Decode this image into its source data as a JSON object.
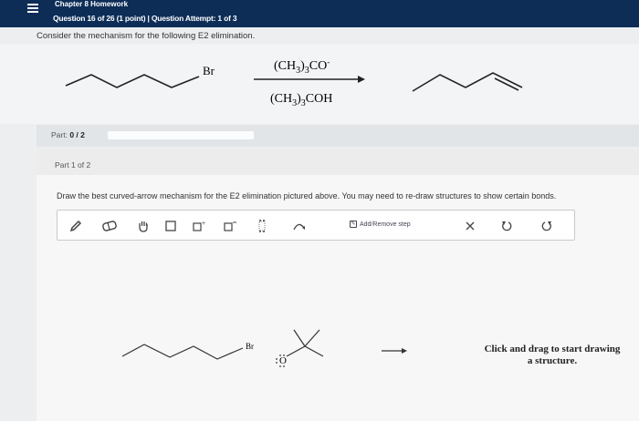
{
  "header": {
    "chapter": "Chapter 8 Homework",
    "question_line": "Question 16 of 26 (1 point)  |  Question Attempt: 1 of 3"
  },
  "prompt": "Consider the mechanism for the following E2 elimination.",
  "reaction": {
    "substrate_label": "Br",
    "reagent_top": {
      "main": "(CH",
      "sub1": "3",
      "mid": ")",
      "sub2": "3",
      "end": "CO",
      "sup": "-"
    },
    "reagent_bottom": {
      "main": "(CH",
      "sub1": "3",
      "mid": ")",
      "sub2": "3",
      "end": "COH"
    }
  },
  "part_bar": {
    "label": "Part:",
    "score": "0 / 2"
  },
  "part_panel": {
    "part_of": "Part 1 of 2",
    "instructions": "Draw the best curved-arrow mechanism for the E2 elimination pictured above. You may need to re-draw structures to show certain bonds."
  },
  "toolbar": {
    "add_remove": "Add/Remove step",
    "icons": [
      "pencil-icon",
      "eraser-icon",
      "hand-icon",
      "square-icon",
      "square-plus-icon",
      "square-minus-icon",
      "dots-icon",
      "curved-arrow-icon",
      "close-icon",
      "undo-icon",
      "redo-icon"
    ]
  },
  "canvas": {
    "substrate_label": "Br",
    "base_label": "O",
    "hint": "Click and drag to start drawing a structure."
  },
  "colors": {
    "header_bg": "#0d2d57",
    "panel_bg": "#f7f7f7"
  }
}
